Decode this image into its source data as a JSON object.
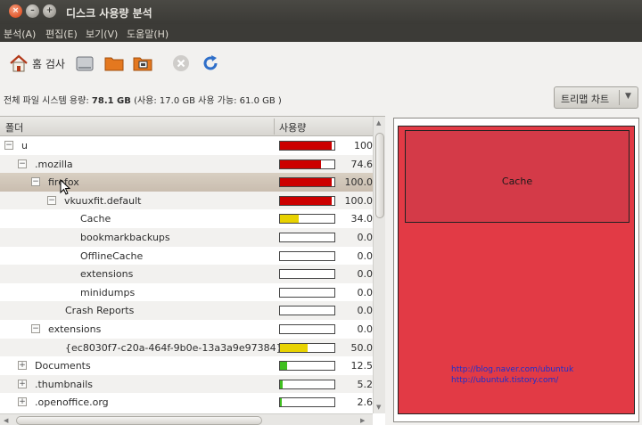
{
  "window": {
    "title": "디스크 사용량 분석",
    "buttons": {
      "close": "×",
      "minimize": "–",
      "maximize": "+"
    }
  },
  "menubar": [
    {
      "label": "분석(A)"
    },
    {
      "label": "편집(E)"
    },
    {
      "label": "보기(V)"
    },
    {
      "label": "도움말(H)"
    }
  ],
  "toolbar": {
    "home_label": "홈 검사",
    "icons": [
      "home-icon",
      "harddisk-icon",
      "folder-icon",
      "remote-folder-icon",
      "stop-icon",
      "refresh-icon"
    ]
  },
  "info": {
    "prefix": "전체 파일 시스템 용량:",
    "total": "78.1 GB",
    "detail": "(사용: 17.0 GB 사용 가능: 61.0 GB )"
  },
  "view_selector": {
    "selected": "트리맵 차트",
    "arrow": "▼"
  },
  "tree": {
    "columns": {
      "folder": "폴더",
      "usage": "사용량"
    },
    "rows": [
      {
        "name": "u",
        "expander": "−",
        "usage": "100",
        "fill": 1.0,
        "color": "#cc0000"
      },
      {
        "name": ".mozilla",
        "expander": "−",
        "usage": "74.6",
        "fill": 0.746,
        "color": "#cc0000"
      },
      {
        "name": "firefox",
        "expander": "−",
        "usage": "100.0",
        "fill": 1.0,
        "color": "#cc0000"
      },
      {
        "name": "vkuuxfit.default",
        "expander": "−",
        "usage": "100.0",
        "fill": 1.0,
        "color": "#cc0000"
      },
      {
        "name": "Cache",
        "expander": "",
        "usage": "34.0",
        "fill": 0.34,
        "color": "#e8d200"
      },
      {
        "name": "bookmarkbackups",
        "expander": "",
        "usage": "0.0",
        "fill": 0,
        "color": "#cc0000"
      },
      {
        "name": "OfflineCache",
        "expander": "",
        "usage": "0.0",
        "fill": 0,
        "color": "#cc0000"
      },
      {
        "name": "extensions",
        "expander": "",
        "usage": "0.0",
        "fill": 0,
        "color": "#cc0000"
      },
      {
        "name": "minidumps",
        "expander": "",
        "usage": "0.0",
        "fill": 0,
        "color": "#cc0000"
      },
      {
        "name": "Crash Reports",
        "expander": "",
        "usage": "0.0",
        "fill": 0,
        "color": "#cc0000"
      },
      {
        "name": "extensions",
        "expander": "−",
        "usage": "0.0",
        "fill": 0,
        "color": "#cc0000"
      },
      {
        "name": "{ec8030f7-c20a-464f-9b0e-13a3a9e97384}",
        "expander": "",
        "usage": "50.0",
        "fill": 0.5,
        "color": "#e8d200"
      },
      {
        "name": "Documents",
        "expander": "+",
        "usage": "12.5",
        "fill": 0.125,
        "color": "#3fbf1f"
      },
      {
        "name": ".thumbnails",
        "expander": "+",
        "usage": "5.2",
        "fill": 0.052,
        "color": "#3fbf1f"
      },
      {
        "name": ".openoffice.org",
        "expander": "+",
        "usage": "2.6",
        "fill": 0.026,
        "color": "#3fbf1f"
      }
    ]
  },
  "treemap": {
    "cache_label": "Cache",
    "urls": [
      "http://blog.naver.com/ubuntuk",
      "http://ubuntuk.tistory.com/"
    ]
  }
}
